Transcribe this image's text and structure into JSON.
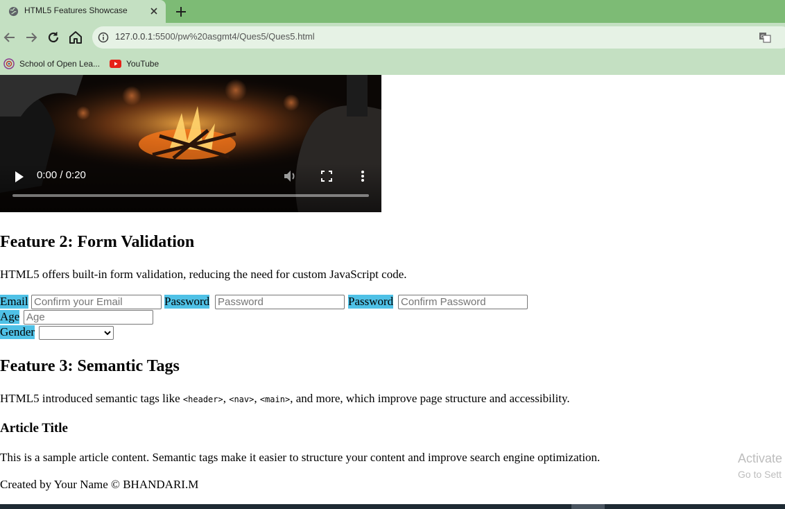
{
  "browser": {
    "tab_title": "HTML5 Features Showcase",
    "url_host": "127.0.0.1",
    "url_rest": ":5500/pw%20asgmt4/Ques5/Ques5.html",
    "bookmarks": [
      {
        "label": "School of Open Lea...",
        "icon": "school-logo-icon"
      },
      {
        "label": "YouTube",
        "icon": "youtube-icon"
      }
    ],
    "colors": {
      "frame": "#7dbb75",
      "toolbar": "#c4e0c2"
    }
  },
  "video": {
    "time": "0:00 / 0:20",
    "progress": 0
  },
  "feature2": {
    "heading": "Feature 2: Form Validation",
    "description": "HTML5 offers built-in form validation, reducing the need for custom JavaScript code.",
    "email_label": "Email",
    "email_placeholder": "Confirm your Email",
    "password_label": "Password",
    "password_placeholder": "Password",
    "confirm_label": "Password",
    "confirm_placeholder": "Confirm Password",
    "age_label": "Age",
    "age_placeholder": "Age",
    "gender_label": "Gender",
    "gender_value": ""
  },
  "feature3": {
    "heading": "Feature 3: Semantic Tags",
    "desc_before": "HTML5 introduced semantic tags like ",
    "tag1": "<header>",
    "sep1": ", ",
    "tag2": "<nav>",
    "sep2": ", ",
    "tag3": "<main>",
    "desc_after": ", and more, which improve page structure and accessibility.",
    "article_title": "Article Title",
    "article_text": "This is a sample article content. Semantic tags make it easier to structure your content and improve search engine optimization."
  },
  "footer": {
    "text": "Created by Your Name © BHANDARI.M"
  },
  "watermark": {
    "line1": "Activate",
    "line2": "Go to Sett"
  },
  "label_color": "#4fc1e6"
}
